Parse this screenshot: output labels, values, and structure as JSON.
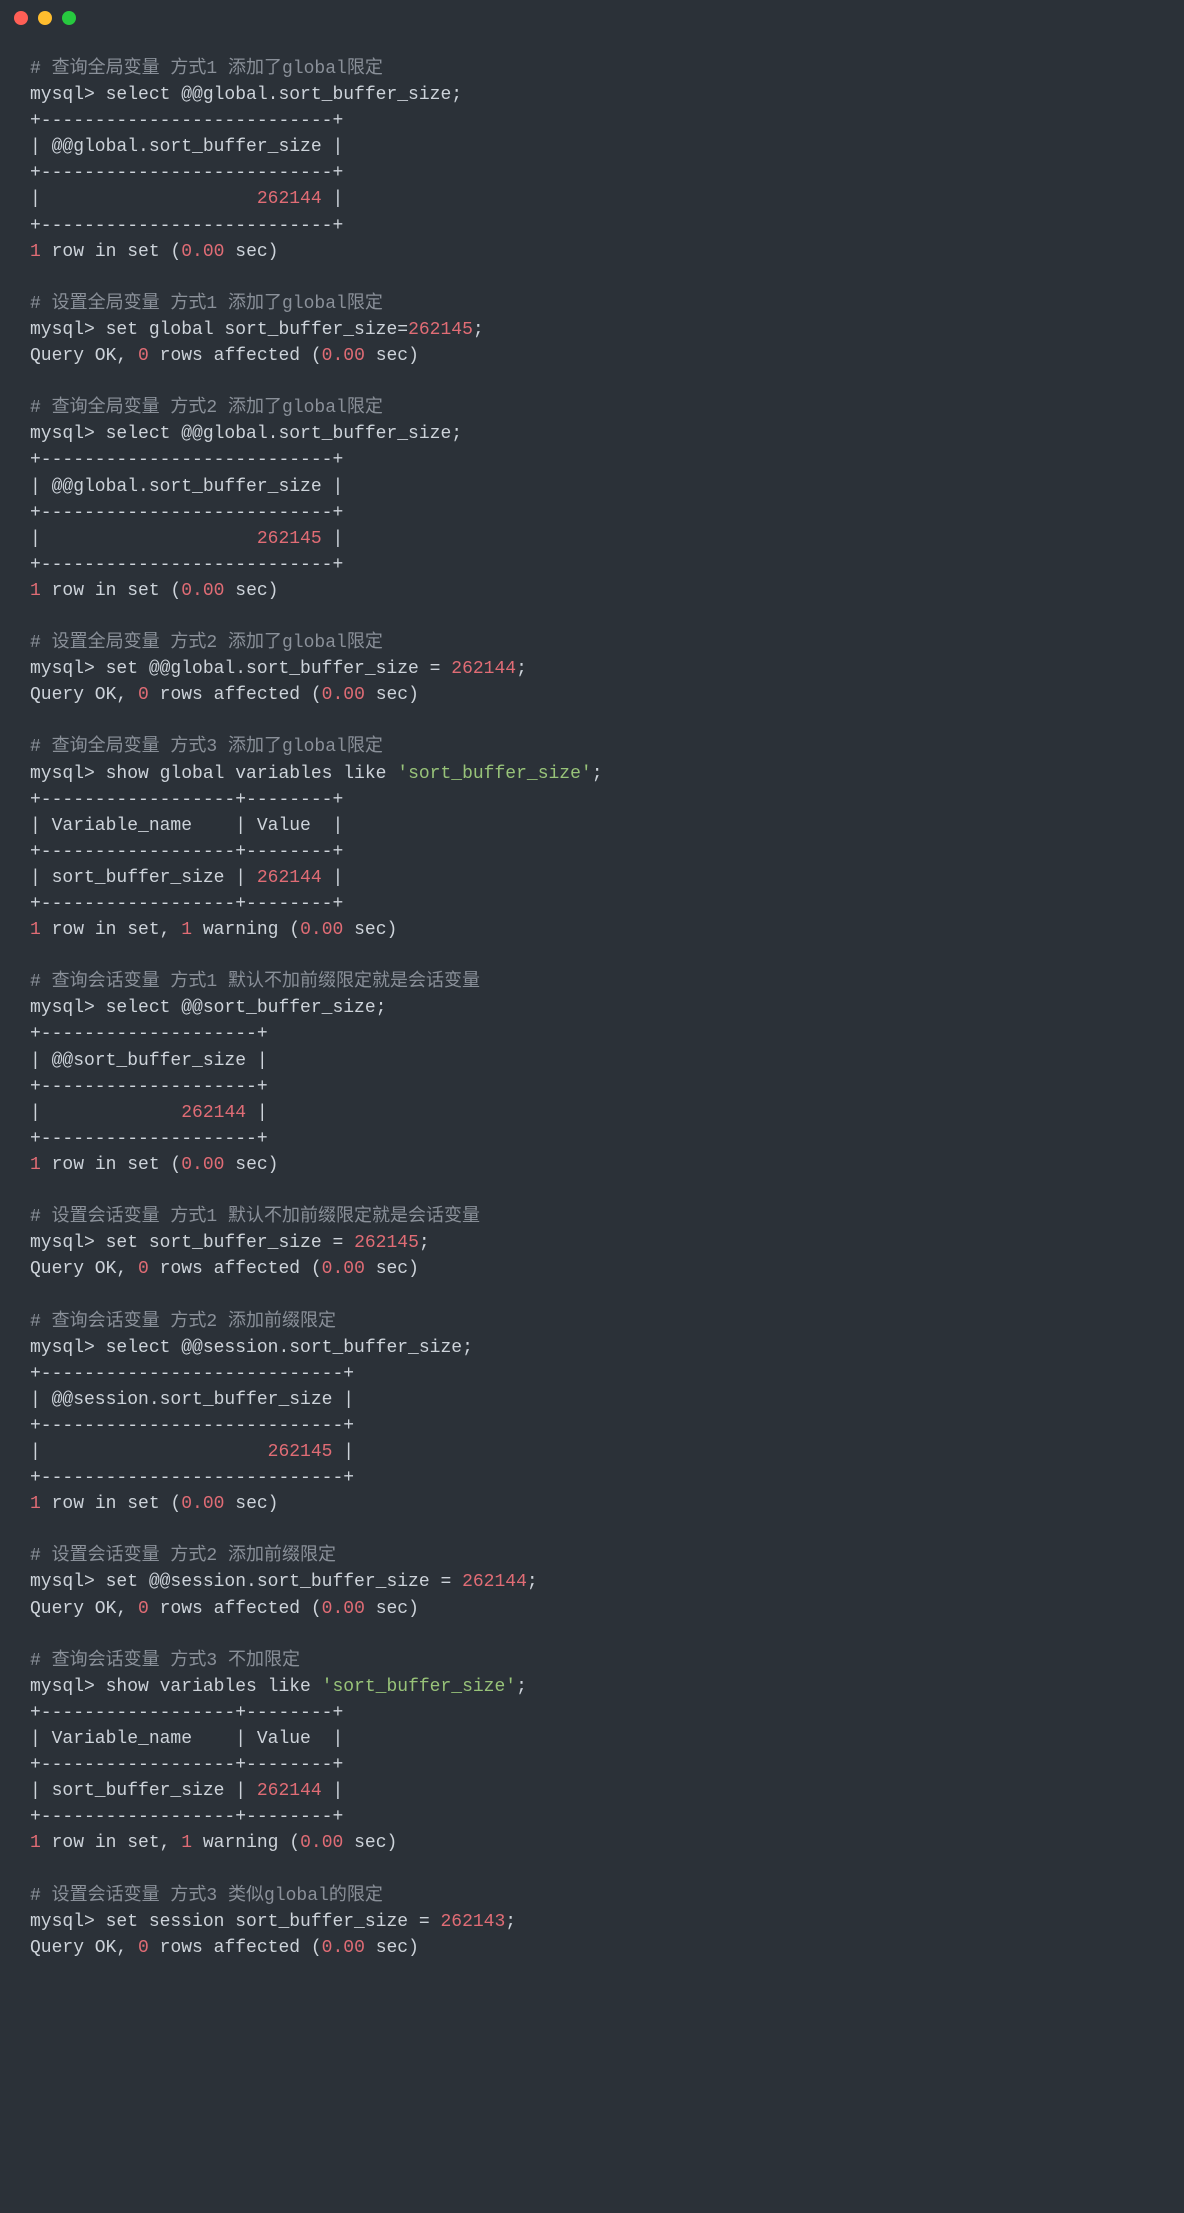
{
  "titlebar": {
    "dots": [
      "red",
      "yellow",
      "green"
    ]
  },
  "content": {
    "lines": [
      {
        "segs": [
          {
            "c": "grey",
            "t": "# 查询全局变量 方式1 添加了global限定"
          }
        ]
      },
      {
        "segs": [
          {
            "c": "white",
            "t": "mysql> select @@global.sort_buffer_size;"
          }
        ]
      },
      {
        "segs": [
          {
            "c": "white",
            "t": "+---------------------------+"
          }
        ]
      },
      {
        "segs": [
          {
            "c": "white",
            "t": "| @@global.sort_buffer_size |"
          }
        ]
      },
      {
        "segs": [
          {
            "c": "white",
            "t": "+---------------------------+"
          }
        ]
      },
      {
        "segs": [
          {
            "c": "white",
            "t": "|                    "
          },
          {
            "c": "red",
            "t": "262144"
          },
          {
            "c": "white",
            "t": " |"
          }
        ]
      },
      {
        "segs": [
          {
            "c": "white",
            "t": "+---------------------------+"
          }
        ]
      },
      {
        "segs": [
          {
            "c": "red",
            "t": "1"
          },
          {
            "c": "white",
            "t": " row in set ("
          },
          {
            "c": "red",
            "t": "0.00"
          },
          {
            "c": "white",
            "t": " sec)"
          }
        ]
      },
      {
        "segs": [
          {
            "c": "white",
            "t": ""
          }
        ]
      },
      {
        "segs": [
          {
            "c": "grey",
            "t": "# 设置全局变量 方式1 添加了global限定"
          }
        ]
      },
      {
        "segs": [
          {
            "c": "white",
            "t": "mysql> set global sort_buffer_size="
          },
          {
            "c": "red",
            "t": "262145"
          },
          {
            "c": "white",
            "t": ";"
          }
        ]
      },
      {
        "segs": [
          {
            "c": "white",
            "t": "Query OK, "
          },
          {
            "c": "red",
            "t": "0"
          },
          {
            "c": "white",
            "t": " rows affected ("
          },
          {
            "c": "red",
            "t": "0.00"
          },
          {
            "c": "white",
            "t": " sec)"
          }
        ]
      },
      {
        "segs": [
          {
            "c": "white",
            "t": ""
          }
        ]
      },
      {
        "segs": [
          {
            "c": "grey",
            "t": "# 查询全局变量 方式2 添加了global限定"
          }
        ]
      },
      {
        "segs": [
          {
            "c": "white",
            "t": "mysql> select @@global.sort_buffer_size;"
          }
        ]
      },
      {
        "segs": [
          {
            "c": "white",
            "t": "+---------------------------+"
          }
        ]
      },
      {
        "segs": [
          {
            "c": "white",
            "t": "| @@global.sort_buffer_size |"
          }
        ]
      },
      {
        "segs": [
          {
            "c": "white",
            "t": "+---------------------------+"
          }
        ]
      },
      {
        "segs": [
          {
            "c": "white",
            "t": "|                    "
          },
          {
            "c": "red",
            "t": "262145"
          },
          {
            "c": "white",
            "t": " |"
          }
        ]
      },
      {
        "segs": [
          {
            "c": "white",
            "t": "+---------------------------+"
          }
        ]
      },
      {
        "segs": [
          {
            "c": "red",
            "t": "1"
          },
          {
            "c": "white",
            "t": " row in set ("
          },
          {
            "c": "red",
            "t": "0.00"
          },
          {
            "c": "white",
            "t": " sec)"
          }
        ]
      },
      {
        "segs": [
          {
            "c": "white",
            "t": ""
          }
        ]
      },
      {
        "segs": [
          {
            "c": "grey",
            "t": "# 设置全局变量 方式2 添加了global限定"
          }
        ]
      },
      {
        "segs": [
          {
            "c": "white",
            "t": "mysql> set @@global.sort_buffer_size = "
          },
          {
            "c": "red",
            "t": "262144"
          },
          {
            "c": "white",
            "t": ";"
          }
        ]
      },
      {
        "segs": [
          {
            "c": "white",
            "t": "Query OK, "
          },
          {
            "c": "red",
            "t": "0"
          },
          {
            "c": "white",
            "t": " rows affected ("
          },
          {
            "c": "red",
            "t": "0.00"
          },
          {
            "c": "white",
            "t": " sec)"
          }
        ]
      },
      {
        "segs": [
          {
            "c": "white",
            "t": ""
          }
        ]
      },
      {
        "segs": [
          {
            "c": "grey",
            "t": "# 查询全局变量 方式3 添加了global限定"
          }
        ]
      },
      {
        "segs": [
          {
            "c": "white",
            "t": "mysql> show global variables like "
          },
          {
            "c": "green",
            "t": "'sort_buffer_size'"
          },
          {
            "c": "white",
            "t": ";"
          }
        ]
      },
      {
        "segs": [
          {
            "c": "white",
            "t": "+------------------+--------+"
          }
        ]
      },
      {
        "segs": [
          {
            "c": "white",
            "t": "| Variable_name    | Value  |"
          }
        ]
      },
      {
        "segs": [
          {
            "c": "white",
            "t": "+------------------+--------+"
          }
        ]
      },
      {
        "segs": [
          {
            "c": "white",
            "t": "| sort_buffer_size | "
          },
          {
            "c": "red",
            "t": "262144"
          },
          {
            "c": "white",
            "t": " |"
          }
        ]
      },
      {
        "segs": [
          {
            "c": "white",
            "t": "+------------------+--------+"
          }
        ]
      },
      {
        "segs": [
          {
            "c": "red",
            "t": "1"
          },
          {
            "c": "white",
            "t": " row in set, "
          },
          {
            "c": "red",
            "t": "1"
          },
          {
            "c": "white",
            "t": " warning ("
          },
          {
            "c": "red",
            "t": "0.00"
          },
          {
            "c": "white",
            "t": " sec)"
          }
        ]
      },
      {
        "segs": [
          {
            "c": "white",
            "t": ""
          }
        ]
      },
      {
        "segs": [
          {
            "c": "grey",
            "t": "# 查询会话变量 方式1 默认不加前缀限定就是会话变量"
          }
        ]
      },
      {
        "segs": [
          {
            "c": "white",
            "t": "mysql> select @@sort_buffer_size;"
          }
        ]
      },
      {
        "segs": [
          {
            "c": "white",
            "t": "+--------------------+"
          }
        ]
      },
      {
        "segs": [
          {
            "c": "white",
            "t": "| @@sort_buffer_size |"
          }
        ]
      },
      {
        "segs": [
          {
            "c": "white",
            "t": "+--------------------+"
          }
        ]
      },
      {
        "segs": [
          {
            "c": "white",
            "t": "|             "
          },
          {
            "c": "red",
            "t": "262144"
          },
          {
            "c": "white",
            "t": " |"
          }
        ]
      },
      {
        "segs": [
          {
            "c": "white",
            "t": "+--------------------+"
          }
        ]
      },
      {
        "segs": [
          {
            "c": "red",
            "t": "1"
          },
          {
            "c": "white",
            "t": " row in set ("
          },
          {
            "c": "red",
            "t": "0.00"
          },
          {
            "c": "white",
            "t": " sec)"
          }
        ]
      },
      {
        "segs": [
          {
            "c": "white",
            "t": ""
          }
        ]
      },
      {
        "segs": [
          {
            "c": "grey",
            "t": "# 设置会话变量 方式1 默认不加前缀限定就是会话变量"
          }
        ]
      },
      {
        "segs": [
          {
            "c": "white",
            "t": "mysql> set sort_buffer_size = "
          },
          {
            "c": "red",
            "t": "262145"
          },
          {
            "c": "white",
            "t": ";"
          }
        ]
      },
      {
        "segs": [
          {
            "c": "white",
            "t": "Query OK, "
          },
          {
            "c": "red",
            "t": "0"
          },
          {
            "c": "white",
            "t": " rows affected ("
          },
          {
            "c": "red",
            "t": "0.00"
          },
          {
            "c": "white",
            "t": " sec)"
          }
        ]
      },
      {
        "segs": [
          {
            "c": "white",
            "t": ""
          }
        ]
      },
      {
        "segs": [
          {
            "c": "grey",
            "t": "# 查询会话变量 方式2 添加前缀限定"
          }
        ]
      },
      {
        "segs": [
          {
            "c": "white",
            "t": "mysql> select @@session.sort_buffer_size;"
          }
        ]
      },
      {
        "segs": [
          {
            "c": "white",
            "t": "+----------------------------+"
          }
        ]
      },
      {
        "segs": [
          {
            "c": "white",
            "t": "| @@session.sort_buffer_size |"
          }
        ]
      },
      {
        "segs": [
          {
            "c": "white",
            "t": "+----------------------------+"
          }
        ]
      },
      {
        "segs": [
          {
            "c": "white",
            "t": "|                     "
          },
          {
            "c": "red",
            "t": "262145"
          },
          {
            "c": "white",
            "t": " |"
          }
        ]
      },
      {
        "segs": [
          {
            "c": "white",
            "t": "+----------------------------+"
          }
        ]
      },
      {
        "segs": [
          {
            "c": "red",
            "t": "1"
          },
          {
            "c": "white",
            "t": " row in set ("
          },
          {
            "c": "red",
            "t": "0.00"
          },
          {
            "c": "white",
            "t": " sec)"
          }
        ]
      },
      {
        "segs": [
          {
            "c": "white",
            "t": ""
          }
        ]
      },
      {
        "segs": [
          {
            "c": "grey",
            "t": "# 设置会话变量 方式2 添加前缀限定"
          }
        ]
      },
      {
        "segs": [
          {
            "c": "white",
            "t": "mysql> set @@session.sort_buffer_size = "
          },
          {
            "c": "red",
            "t": "262144"
          },
          {
            "c": "white",
            "t": ";"
          }
        ]
      },
      {
        "segs": [
          {
            "c": "white",
            "t": "Query OK, "
          },
          {
            "c": "red",
            "t": "0"
          },
          {
            "c": "white",
            "t": " rows affected ("
          },
          {
            "c": "red",
            "t": "0.00"
          },
          {
            "c": "white",
            "t": " sec)"
          }
        ]
      },
      {
        "segs": [
          {
            "c": "white",
            "t": ""
          }
        ]
      },
      {
        "segs": [
          {
            "c": "grey",
            "t": "# 查询会话变量 方式3 不加限定"
          }
        ]
      },
      {
        "segs": [
          {
            "c": "white",
            "t": "mysql> show variables like "
          },
          {
            "c": "green",
            "t": "'sort_buffer_size'"
          },
          {
            "c": "white",
            "t": ";"
          }
        ]
      },
      {
        "segs": [
          {
            "c": "white",
            "t": "+------------------+--------+"
          }
        ]
      },
      {
        "segs": [
          {
            "c": "white",
            "t": "| Variable_name    | Value  |"
          }
        ]
      },
      {
        "segs": [
          {
            "c": "white",
            "t": "+------------------+--------+"
          }
        ]
      },
      {
        "segs": [
          {
            "c": "white",
            "t": "| sort_buffer_size | "
          },
          {
            "c": "red",
            "t": "262144"
          },
          {
            "c": "white",
            "t": " |"
          }
        ]
      },
      {
        "segs": [
          {
            "c": "white",
            "t": "+------------------+--------+"
          }
        ]
      },
      {
        "segs": [
          {
            "c": "red",
            "t": "1"
          },
          {
            "c": "white",
            "t": " row in set, "
          },
          {
            "c": "red",
            "t": "1"
          },
          {
            "c": "white",
            "t": " warning ("
          },
          {
            "c": "red",
            "t": "0.00"
          },
          {
            "c": "white",
            "t": " sec)"
          }
        ]
      },
      {
        "segs": [
          {
            "c": "white",
            "t": ""
          }
        ]
      },
      {
        "segs": [
          {
            "c": "grey",
            "t": "# 设置会话变量 方式3 类似global的限定"
          }
        ]
      },
      {
        "segs": [
          {
            "c": "white",
            "t": "mysql> set session sort_buffer_size = "
          },
          {
            "c": "red",
            "t": "262143"
          },
          {
            "c": "white",
            "t": ";"
          }
        ]
      },
      {
        "segs": [
          {
            "c": "white",
            "t": "Query OK, "
          },
          {
            "c": "red",
            "t": "0"
          },
          {
            "c": "white",
            "t": " rows affected ("
          },
          {
            "c": "red",
            "t": "0.00"
          },
          {
            "c": "white",
            "t": " sec)"
          }
        ]
      }
    ]
  }
}
